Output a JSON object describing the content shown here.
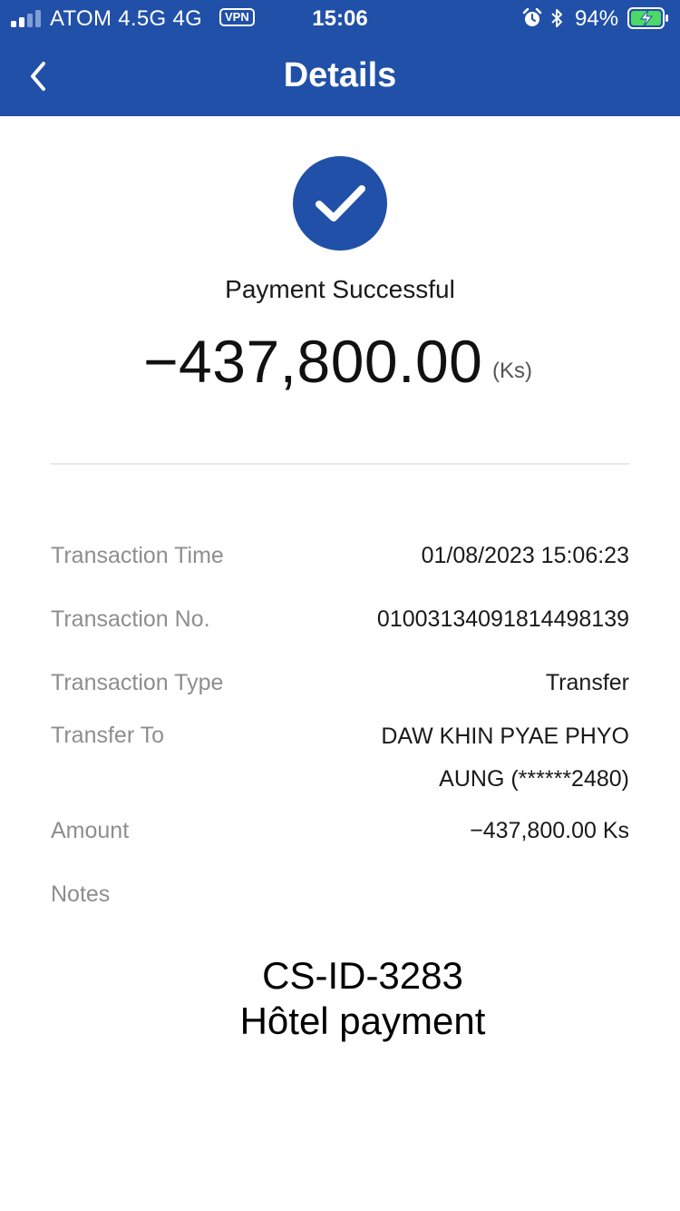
{
  "status_bar": {
    "carrier": "ATOM 4.5G  4G",
    "vpn": "VPN",
    "time": "15:06",
    "battery": "94%",
    "icons": [
      "signal-icon",
      "alarm-icon",
      "bluetooth-icon",
      "battery-charging-icon"
    ]
  },
  "header": {
    "title": "Details",
    "back_icon": "chevron-left-icon",
    "color": "#2150a8"
  },
  "result": {
    "icon": "check-circle-icon",
    "status": "Payment Successful",
    "amount": "−437,800.00",
    "currency": "(Ks)"
  },
  "details": {
    "time_label": "Transaction Time",
    "time_value": "01/08/2023 15:06:23",
    "no_label": "Transaction No.",
    "no_value": "01003134091814498139",
    "type_label": "Transaction Type",
    "type_value": "Transfer",
    "to_label": "Transfer To",
    "to_value_line1": "DAW KHIN PYAE PHYO",
    "to_value_line2": "AUNG (******2480)",
    "amount_label": "Amount",
    "amount_value": "−437,800.00 Ks",
    "notes_label": "Notes"
  },
  "notes": {
    "line1": "CS-ID-3283",
    "line2": "Hôtel payment"
  }
}
